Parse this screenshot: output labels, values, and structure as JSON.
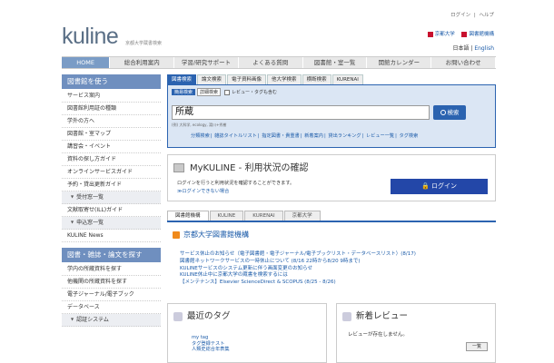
{
  "header": {
    "login": "ログイン",
    "help": "ヘルプ",
    "logo": "kuline",
    "logo_sub": "京都大学蔵書検索",
    "univ_link": "京都大学",
    "libnet_link": "図書館機構",
    "lang_ja": "日本語",
    "lang_en": "English"
  },
  "mainnav": [
    "HOME",
    "総合利用案内",
    "学習/研究サポート",
    "よくある質問",
    "図書館・室一覧",
    "開館カレンダー",
    "お問い合わせ"
  ],
  "sidebar": {
    "section1_title": "図書館を使う",
    "section1_items": [
      "サービス案内",
      "図書館利用証の種類",
      "学外の方へ",
      "図書館・室マップ",
      "講習会・イベント",
      "資料の探し方ガイド",
      "オンラインサービスガイド",
      "予約・貸出更新ガイド"
    ],
    "sub1": "受付窓一覧",
    "after_sub1": "文献取寄せ(ILL)ガイド",
    "sub2": "申込窓一覧",
    "news": "KULINE News",
    "section2_title": "図書・雑誌・論文を探す",
    "section2_items": [
      "学内の所蔵資料を探す",
      "他機関の所蔵資料を探す",
      "電子ジャーナル/電子ブック",
      "データベース"
    ],
    "sub3": "認証システム"
  },
  "search": {
    "tabs": [
      "図書検索",
      "論文検索",
      "電子資料画像",
      "他大学検索",
      "横断検索",
      "KURENAI"
    ],
    "sub_simple": "簡易検索",
    "sub_detail": "詳細検索",
    "sub_review": "レビュー・タグも含む",
    "query": "所蔵",
    "button": "検索",
    "hint": "(例) 大科学, ecology, 湯川+秀樹",
    "links": [
      "分類検索",
      "雑誌タイトルリスト",
      "指定図書・貴重書",
      "新着案内",
      "貸出ランキング",
      "レビュー一覧",
      "タグ検索"
    ]
  },
  "mykuline": {
    "title": "MyKULINE - 利用状況の確認",
    "text": "ログインを行うと利用状況を確認することができます。",
    "link": "≫ログインできない場合",
    "login_button": "ログイン"
  },
  "news": {
    "tabs": [
      "図書館機構",
      "KULINE",
      "KURENAI",
      "京都大学"
    ],
    "title": "京都大学図書館機構",
    "items": [
      "サービス休止のお知らせ（電子図書館・電子ジャーナル/電子ブックリスト・データベースリスト）(8/17)",
      "図書館ネットワークサービスの一時休止について (8/16 22時から8/20 9時まで)",
      "KULINEサービスのシステム更新に伴う画面変更のお知らせ",
      "KULINE休止中に京都大学の蔵書を検索するには",
      "【メンテナンス】Elsevier ScienceDirect & SCOPUS (8/25 - 8/26)"
    ]
  },
  "tags": {
    "title": "最近のタグ",
    "items": [
      "my tag",
      "タグ登録テスト",
      "人類史総合年表集"
    ]
  },
  "reviews": {
    "title": "新着レビュー",
    "text": "レビューが存在しません。",
    "list_button": "一覧"
  }
}
